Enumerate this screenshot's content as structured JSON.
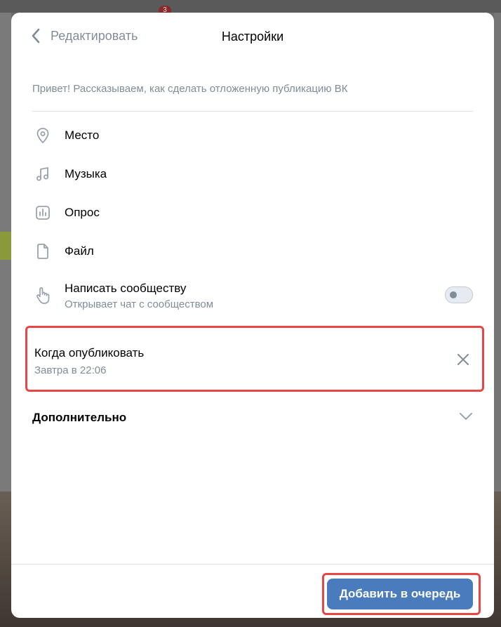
{
  "background": {
    "notification_count": "3"
  },
  "header": {
    "back_label": "Редактировать",
    "title": "Настройки"
  },
  "intro_text": "Привет! Рассказываем, как сделать отложенную публикацию ВК",
  "attachments": [
    {
      "label": "Место",
      "icon": "location-pin-icon"
    },
    {
      "label": "Музыка",
      "icon": "music-note-icon"
    },
    {
      "label": "Опрос",
      "icon": "poll-icon"
    },
    {
      "label": "Файл",
      "icon": "file-icon"
    }
  ],
  "message_community": {
    "label": "Написать сообществу",
    "sublabel": "Открывает чат с сообществом",
    "icon": "pointing-hand-icon",
    "enabled": false
  },
  "schedule": {
    "label": "Когда опубликовать",
    "value": "Завтра в 22:06"
  },
  "additional": {
    "label": "Дополнительно"
  },
  "footer": {
    "submit_label": "Добавить в очередь"
  },
  "colors": {
    "accent": "#4a7bbd",
    "highlight": "#e64646",
    "muted": "#818c99"
  }
}
